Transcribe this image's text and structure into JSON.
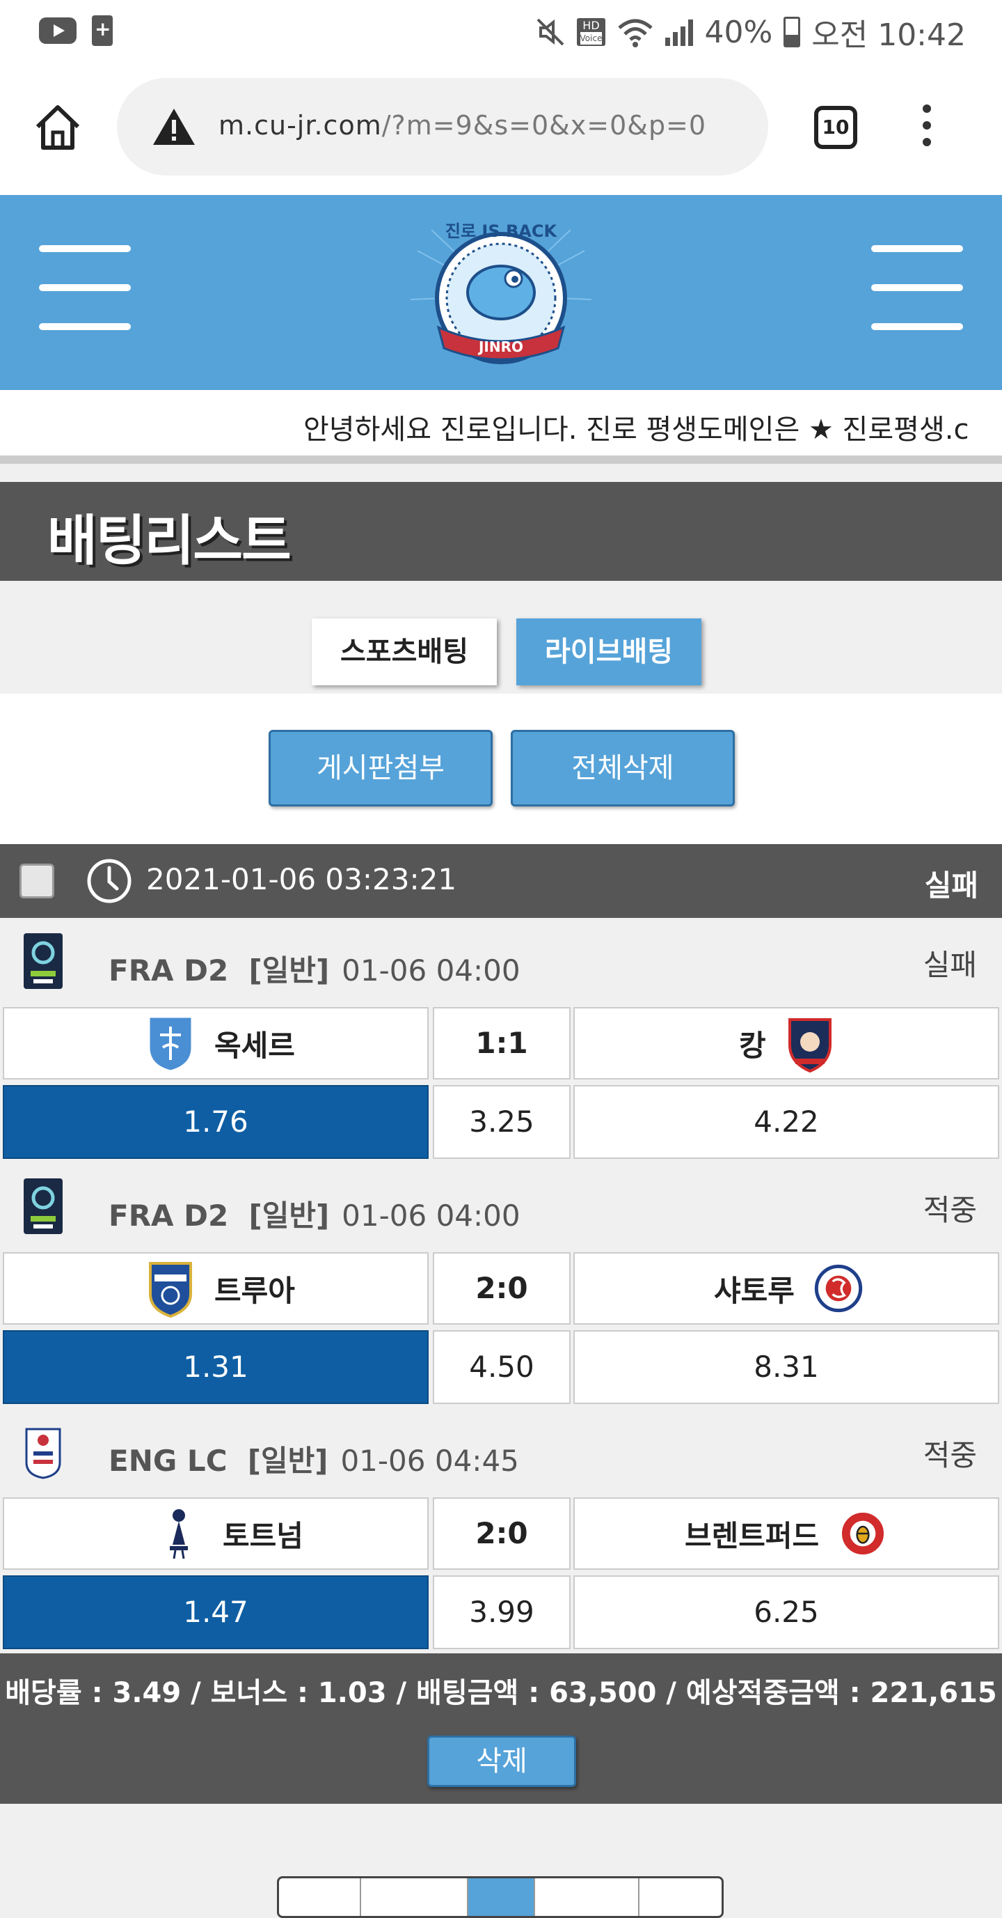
{
  "status_bar": {
    "battery": "40%",
    "time": "오전 10:42",
    "hd_label": "HD",
    "voice_label": "Voice"
  },
  "browser": {
    "url_host": "m.cu-jr.com",
    "url_path": "/?m=9&s=0&x=0&p=0",
    "tab_count": "10"
  },
  "site": {
    "logo_text_top": "진로 IS BACK",
    "logo_banner": "JINRO",
    "notice": "안녕하세요 진로입니다. 진로 평생도메인은 ★ 진로평생.c"
  },
  "page_title": "배팅리스트",
  "tabs": [
    {
      "label": "스포츠배팅",
      "active": false
    },
    {
      "label": "라이브배팅",
      "active": true
    }
  ],
  "actions": {
    "attach_label": "게시판첨부",
    "delete_all_label": "전체삭제"
  },
  "slip": {
    "datetime": "2021-01-06 03:23:21",
    "status": "실패",
    "matches": [
      {
        "league": "FRA D2",
        "type": "[일반]",
        "datetime": "01-06 04:00",
        "result": "실패",
        "home": "옥세르",
        "score": "1:1",
        "away": "캉",
        "odds": {
          "home": "1.76",
          "draw": "3.25",
          "away": "4.22"
        },
        "selected": "home"
      },
      {
        "league": "FRA D2",
        "type": "[일반]",
        "datetime": "01-06 04:00",
        "result": "적중",
        "home": "트루아",
        "score": "2:0",
        "away": "샤토루",
        "odds": {
          "home": "1.31",
          "draw": "4.50",
          "away": "8.31"
        },
        "selected": "home"
      },
      {
        "league": "ENG LC",
        "type": "[일반]",
        "datetime": "01-06 04:45",
        "result": "적중",
        "home": "토트넘",
        "score": "2:0",
        "away": "브렌트퍼드",
        "odds": {
          "home": "1.47",
          "draw": "3.99",
          "away": "6.25"
        },
        "selected": "home"
      }
    ],
    "summary": "배당률 : 3.49 / 보너스 : 1.03 / 배팅금액 : 63,500 / 예상적중금액 : 221,615",
    "delete_label": "삭제"
  },
  "colors": {
    "brand_blue": "#56a3d9",
    "selected_odd": "#0f5ea3",
    "dark_bar": "#565656"
  },
  "icons": [
    "youtube-icon",
    "battery-saver-icon",
    "mute-icon",
    "wifi-icon",
    "signal-icon",
    "battery-icon",
    "home-icon",
    "warning-icon",
    "tabs-icon",
    "kebab-menu-icon",
    "hamburger-icon",
    "clock-icon",
    "checkbox-icon"
  ]
}
